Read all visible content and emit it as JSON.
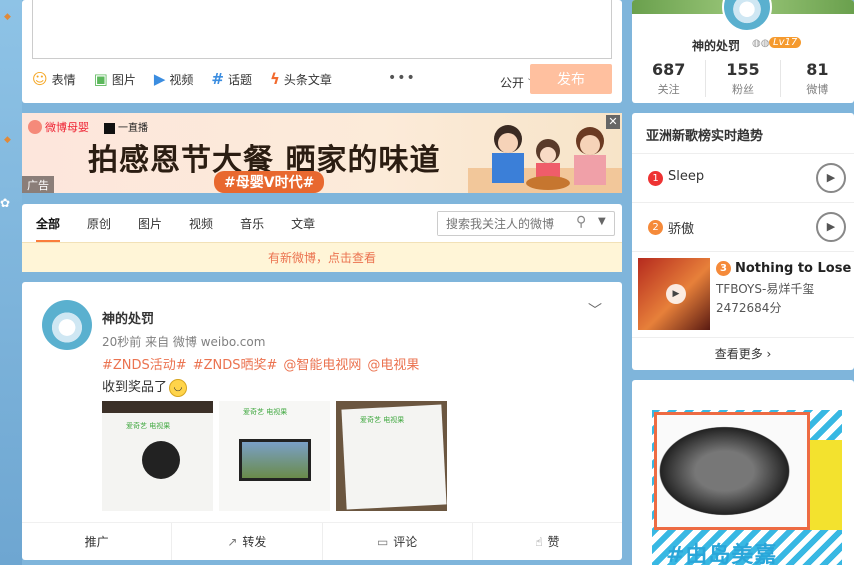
{
  "composer": {
    "tools": [
      {
        "icon": "smile-icon",
        "glyph": "☺",
        "color": "#f5a623",
        "label": "表情"
      },
      {
        "icon": "image-icon",
        "glyph": "▣",
        "color": "#5cb85c",
        "label": "图片"
      },
      {
        "icon": "video-icon",
        "glyph": "▶",
        "color": "#3b8de0",
        "label": "视频"
      },
      {
        "icon": "hashtag-icon",
        "glyph": "#",
        "color": "#3b8de0",
        "label": "话题"
      },
      {
        "icon": "lightning-icon",
        "glyph": "ϟ",
        "color": "#f26a2e",
        "label": "头条文章"
      }
    ],
    "more": "•••",
    "visibility": "公开",
    "visibility_caret": "﹀",
    "post_label": "发布"
  },
  "banner": {
    "logo_weibo": "微博母婴",
    "logo_partner": "一直播",
    "title": "拍感恩节大餐 晒家的味道",
    "subtitle": "#母婴V时代#",
    "ad_tag": "广告",
    "close": "✕"
  },
  "feed": {
    "tabs": [
      "全部",
      "原创",
      "图片",
      "视频",
      "音乐",
      "文章"
    ],
    "search_placeholder": "搜索我关注人的微博",
    "new_notice": "有新微博，点击查看"
  },
  "post": {
    "author": "神的处罚",
    "meta": "20秒前 来自 微博 weibo.com",
    "tags": [
      "#ZNDS活动#",
      "#ZNDS晒奖#",
      "@智能电视网",
      "@电视果"
    ],
    "text": "收到奖品了",
    "thumb_label": "爱奇艺 电视果",
    "actions": [
      {
        "icon": "promote-icon",
        "glyph": "",
        "label": "推广"
      },
      {
        "icon": "repost-icon",
        "glyph": "↗",
        "label": "转发"
      },
      {
        "icon": "comment-icon",
        "glyph": "▭",
        "label": "评论"
      },
      {
        "icon": "like-icon",
        "glyph": "👍",
        "label": "赞"
      }
    ]
  },
  "profile": {
    "name": "神的处罚",
    "vip": "◍◍",
    "level": "Lv17",
    "stats": [
      {
        "num": "687",
        "label": "关注"
      },
      {
        "num": "155",
        "label": "粉丝"
      },
      {
        "num": "81",
        "label": "微博"
      }
    ]
  },
  "chart": {
    "title": "亚洲新歌榜实时趋势",
    "songs": [
      {
        "rank": "1",
        "title": "Sleep"
      },
      {
        "rank": "2",
        "title": "骄傲"
      }
    ],
    "featured": {
      "rank": "3",
      "title": "Nothing to Lose",
      "artist": "TFBOYS-易烊千玺",
      "score": "2472684分"
    },
    "see_more": "查看更多 ›",
    "play": "▶"
  },
  "ad_right": {
    "text": "#由岛美嘉"
  },
  "colors": {
    "accent": "#fa7d3c",
    "link": "#eb7350",
    "post_button_disabled": "#ffc09f",
    "background": "#7fb5db"
  }
}
